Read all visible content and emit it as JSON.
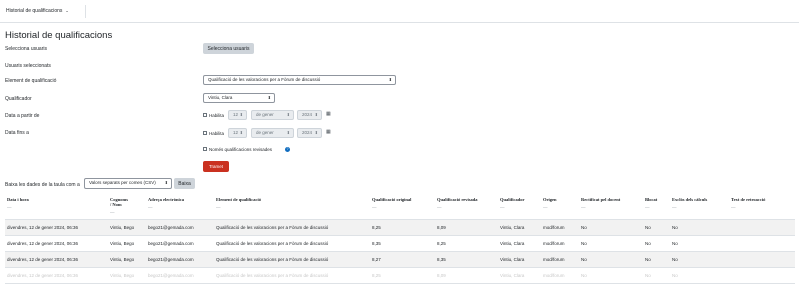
{
  "topbar": {
    "menu_label": "Historial de qualificacions",
    "chevron": "⌄"
  },
  "page_title": "Historial de qualificacions",
  "form": {
    "select_users_label": "Selecciona usuaris",
    "select_users_button": "Selecciona usuaris",
    "selected_users_label": "Usuaris seleccionats",
    "grade_item_label": "Element de qualificació",
    "grade_item_value": "Qualificació de les valoracions per a Fòrum de discussió",
    "grader_label": "Qualificador",
    "grader_value": "Vintiu, Clara",
    "date_from_label": "Data a partir de",
    "date_to_label": "Data fins a",
    "enable_label": "Habilita",
    "date_from": {
      "day": "12",
      "month": "de gener",
      "year": "2024"
    },
    "date_to": {
      "day": "12",
      "month": "de gener",
      "year": "2024"
    },
    "revised_only_label": "Només qualificacions revisades",
    "submit_label": "Tramet"
  },
  "download": {
    "label": "Baixa les dades de la taula com a",
    "format_value": "Valors separats per comes (CSV)",
    "button_label": "Baixa"
  },
  "table": {
    "columns": [
      {
        "l1": "Data i hora",
        "l2": ""
      },
      {
        "l1": "Cognoms",
        "l2": "/ Nom"
      },
      {
        "l1": "Adreça electrònica",
        "l2": ""
      },
      {
        "l1": "Element de qualificació",
        "l2": ""
      },
      {
        "l1": "Qualificació original",
        "l2": ""
      },
      {
        "l1": "Qualificació revisada",
        "l2": ""
      },
      {
        "l1": "Qualificador",
        "l2": ""
      },
      {
        "l1": "Origen",
        "l2": ""
      },
      {
        "l1": "Rectificat pel docent",
        "l2": ""
      },
      {
        "l1": "Blocat",
        "l2": ""
      },
      {
        "l1": "Exclòs dels càlculs",
        "l2": ""
      },
      {
        "l1": "Text de retroacció",
        "l2": ""
      }
    ],
    "dash": "—",
    "rows": [
      [
        "divendres, 12 de gener 2024, 06:36",
        "Vintiu, Bego",
        "bego21@gemada.com",
        "Qualificació de les valoracions per a Fòrum de discussió",
        "8,25",
        "8,09",
        "Vintiu, Clara",
        "mod/forum",
        "No",
        "No",
        "No",
        ""
      ],
      [
        "divendres, 12 de gener 2024, 06:36",
        "Vintiu, Bego",
        "bego21@gemada.com",
        "Qualificació de les valoracions per a Fòrum de discussió",
        "8,35",
        "8,25",
        "Vintiu, Clara",
        "mod/forum",
        "No",
        "No",
        "No",
        ""
      ],
      [
        "divendres, 12 de gener 2024, 06:36",
        "Vintiu, Bego",
        "bego21@gemada.com",
        "Qualificació de les valoracions per a Fòrum de discussió",
        "8,27",
        "8,35",
        "Vintiu, Clara",
        "mod/forum",
        "No",
        "No",
        "No",
        ""
      ]
    ]
  },
  "colors": {
    "accent": "#0f6cbf",
    "submit": "#ca3120",
    "stripe": "#f2f2f2"
  }
}
